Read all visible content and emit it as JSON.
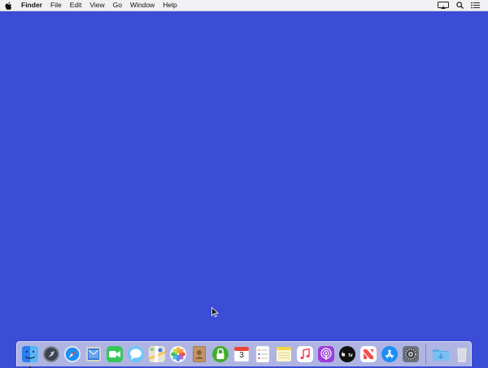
{
  "menubar": {
    "apple_icon": "apple-icon",
    "app_name": "Finder",
    "menus": [
      "File",
      "Edit",
      "View",
      "Go",
      "Window",
      "Help"
    ],
    "status_icons": [
      "display-mirroring-icon",
      "spotlight-search-icon",
      "notification-center-icon"
    ]
  },
  "desktop": {
    "background_color": "#3b4cd6"
  },
  "dock": {
    "apps": [
      {
        "name": "Finder",
        "icon": "finder-icon",
        "running": true
      },
      {
        "name": "Launchpad",
        "icon": "launchpad-icon",
        "running": false
      },
      {
        "name": "Safari",
        "icon": "safari-icon",
        "running": false
      },
      {
        "name": "Mail",
        "icon": "mail-icon",
        "running": false
      },
      {
        "name": "FaceTime",
        "icon": "facetime-icon",
        "running": false
      },
      {
        "name": "Messages",
        "icon": "messages-icon",
        "running": false
      },
      {
        "name": "Maps",
        "icon": "maps-icon",
        "running": false
      },
      {
        "name": "Photos",
        "icon": "photos-icon",
        "running": false
      },
      {
        "name": "Contacts",
        "icon": "contacts-icon",
        "running": false
      },
      {
        "name": "Keychain",
        "icon": "lock-icon",
        "running": false
      },
      {
        "name": "Calendar",
        "icon": "calendar-icon",
        "running": false,
        "day": "3"
      },
      {
        "name": "Reminders",
        "icon": "reminders-icon",
        "running": false
      },
      {
        "name": "Notes",
        "icon": "notes-icon",
        "running": false
      },
      {
        "name": "Music",
        "icon": "music-icon",
        "running": false
      },
      {
        "name": "Podcasts",
        "icon": "podcasts-icon",
        "running": false
      },
      {
        "name": "TV",
        "icon": "apple-tv-icon",
        "running": false
      },
      {
        "name": "News",
        "icon": "news-icon",
        "running": false
      },
      {
        "name": "App Store",
        "icon": "app-store-icon",
        "running": false
      },
      {
        "name": "System Preferences",
        "icon": "system-preferences-icon",
        "running": false
      }
    ],
    "extras": [
      {
        "name": "Downloads",
        "icon": "downloads-folder-icon"
      },
      {
        "name": "Trash",
        "icon": "trash-icon"
      }
    ]
  }
}
